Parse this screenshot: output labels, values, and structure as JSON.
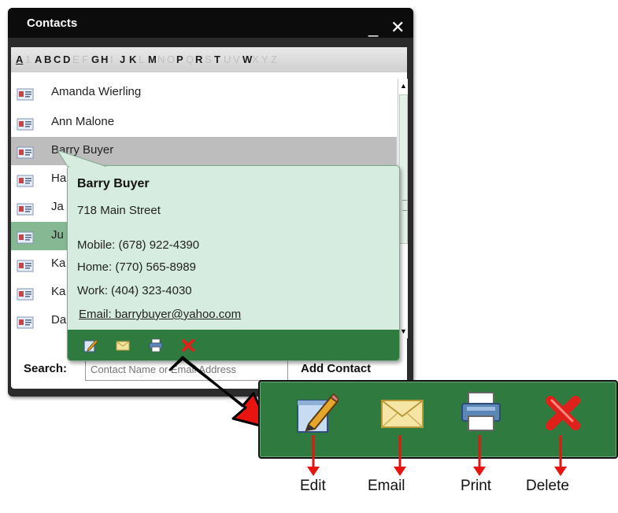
{
  "window": {
    "title": "Contacts",
    "minimize_glyph": "_",
    "close_glyph": "✕"
  },
  "alphabet": [
    {
      "letter": "A",
      "enabled": true,
      "selected": true
    },
    {
      "letter": "1",
      "enabled": false
    },
    {
      "letter": "A",
      "enabled": true
    },
    {
      "letter": "B",
      "enabled": true
    },
    {
      "letter": "C",
      "enabled": true
    },
    {
      "letter": "D",
      "enabled": true
    },
    {
      "letter": "E",
      "enabled": false
    },
    {
      "letter": "F",
      "enabled": false
    },
    {
      "letter": "G",
      "enabled": true
    },
    {
      "letter": "H",
      "enabled": true
    },
    {
      "letter": "I",
      "enabled": false
    },
    {
      "letter": "J",
      "enabled": true
    },
    {
      "letter": "K",
      "enabled": true
    },
    {
      "letter": "L",
      "enabled": false
    },
    {
      "letter": "M",
      "enabled": true
    },
    {
      "letter": "N",
      "enabled": false
    },
    {
      "letter": "O",
      "enabled": false
    },
    {
      "letter": "P",
      "enabled": true
    },
    {
      "letter": "Q",
      "enabled": false
    },
    {
      "letter": "R",
      "enabled": true
    },
    {
      "letter": "S",
      "enabled": false
    },
    {
      "letter": "T",
      "enabled": true
    },
    {
      "letter": "U",
      "enabled": false
    },
    {
      "letter": "V",
      "enabled": false
    },
    {
      "letter": "W",
      "enabled": true
    },
    {
      "letter": "X",
      "enabled": false
    },
    {
      "letter": "Y",
      "enabled": false
    },
    {
      "letter": "Z",
      "enabled": false
    }
  ],
  "contacts": [
    {
      "name": "Amanda Wierling",
      "state": "normal"
    },
    {
      "name": "Ann Malone",
      "state": "normal"
    },
    {
      "name": "Barry Buyer",
      "state": "highlighted"
    },
    {
      "name": "Ha",
      "state": "normal"
    },
    {
      "name": "Ja",
      "state": "normal"
    },
    {
      "name": "Ju",
      "state": "selected"
    },
    {
      "name": "Ka",
      "state": "normal"
    },
    {
      "name": "Ka",
      "state": "normal"
    },
    {
      "name": "Da",
      "state": "normal"
    }
  ],
  "search": {
    "label": "Search:",
    "placeholder": "Contact Name or Email Address",
    "add_contact": "Add Contact"
  },
  "popup": {
    "name": "Barry Buyer",
    "address": "718 Main Street",
    "mobile": "Mobile: (678) 922-4390",
    "home": "Home: (770) 565-8989",
    "work": " Work: (404) 323-4030",
    "email": "Email: barrybuyer@yahoo.com",
    "actions": [
      "edit-icon",
      "email-icon",
      "print-icon",
      "delete-icon"
    ]
  },
  "callout": {
    "labels": {
      "edit": "Edit",
      "email": "Email",
      "print": "Print",
      "delete": "Delete"
    }
  },
  "colors": {
    "title_bar": "#0c0c0c",
    "toolbar_green": "#2f7a3f",
    "popup_bg": "#d7ece0",
    "highlight_row": "#bdbdbd",
    "selected_row": "#86b893",
    "arrow_red": "#e8140f"
  }
}
